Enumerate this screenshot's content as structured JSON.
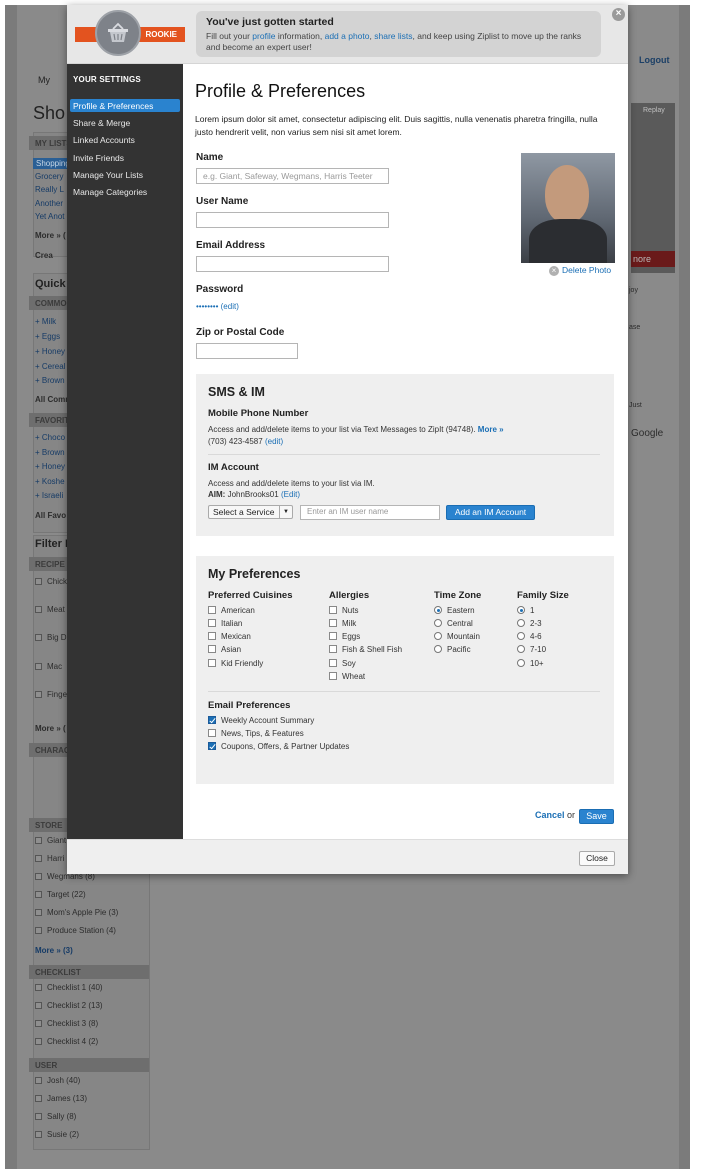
{
  "background": {
    "tab_my": "My",
    "logout": "Logout",
    "title_prefix": "Sho",
    "my_lists_header": "MY LISTS",
    "lists": [
      "Shopping",
      "Grocery",
      "Really L",
      "Another",
      "Yet Anot"
    ],
    "more_lists": "More » (",
    "create": "Crea",
    "quick_header": "Quick",
    "common_header": "COMMON",
    "common_items": [
      "+ Milk",
      "+ Eggs",
      "+ Honey",
      "+ Cereal",
      "+ Brown"
    ],
    "all_common": "All Comm",
    "favorites_header": "FAVORIT",
    "favorite_items": [
      "+ Choco",
      "+ Brown",
      "+ Honey",
      "+ Koshe",
      "+ Israeli"
    ],
    "all_favorites": "All Favo",
    "filter_header": "Filter I",
    "recipe_header": "RECIPE",
    "recipe_items": [
      "Chick",
      "Meat",
      "Big D",
      "Mac",
      "Finge"
    ],
    "more_recipes": "More » (",
    "character_header": "CHARAC",
    "store_header": "STORE",
    "store_items": [
      "Giant",
      "Harri",
      "Wegmans (8)",
      "Target (22)",
      "Mom's Apple Pie (3)",
      "Produce Station (4)"
    ],
    "more_stores": "More » (3)",
    "checklist_header": "CHECKLIST",
    "checklist_items": [
      "Checklist 1 (40)",
      "Checklist 2 (13)",
      "Checklist 3 (8)",
      "Checklist 4 (2)"
    ],
    "user_header": "USER",
    "user_items": [
      "Josh (40)",
      "James (13)",
      "Sally (8)",
      "Susie (2)"
    ],
    "replay": "Replay",
    "more_ad": "nore",
    "side_texts": [
      "joy",
      "ase",
      "Just",
      "Google"
    ]
  },
  "modal": {
    "badge": "ROOKIE",
    "notice_title": "You've just gotten started",
    "notice_text_1": "Fill out your ",
    "notice_link_profile": "profile",
    "notice_text_2": " information, ",
    "notice_link_photo": "add a photo",
    "notice_text_3": ", ",
    "notice_link_share": "share lists",
    "notice_text_4": ", and keep using Ziplist to move up the ranks and become an expert user!",
    "sidebar_header": "YOUR SETTINGS",
    "sidebar_items": [
      "Profile & Preferences",
      "Share & Merge",
      "Linked Accounts",
      "Invite Friends",
      "Manage Your Lists",
      "Manage Categories"
    ],
    "page_title": "Profile & Preferences",
    "intro": "Lorem ipsum dolor sit amet, consectetur adipiscing elit. Duis sagittis, nulla venenatis pharetra fringilla, nulla justo hendrerit velit, non varius sem nisi sit amet lorem.",
    "name_label": "Name",
    "name_placeholder": "e.g. Giant, Safeway, Wegmans, Harris Teeter",
    "username_label": "User Name",
    "email_label": "Email Address",
    "password_label": "Password",
    "password_mask": "••••••••",
    "edit_link": "(edit)",
    "zip_label": "Zip or Postal Code",
    "delete_photo": "Delete Photo",
    "sms_title": "SMS & IM",
    "mobile_label": "Mobile Phone Number",
    "mobile_desc": "Access and add/delete items to your list via Text Messages to ZipIt (94748).",
    "more_link": "More »",
    "phone": "(703) 423-4587",
    "phone_edit": "(edit)",
    "im_label": "IM Account",
    "im_desc": "Access and add/delete items to your list via IM.",
    "aim_label": "AIM:",
    "aim_value": "JohnBrooks01",
    "aim_edit": "(Edit)",
    "service_select": "Select a Service",
    "im_placeholder": "Enter an IM user name",
    "add_im_button": "Add an IM Account",
    "pref_title": "My Preferences",
    "cuisines_header": "Preferred Cuisines",
    "cuisines": [
      "American",
      "Italian",
      "Mexican",
      "Asian",
      "Kid Friendly"
    ],
    "allergies_header": "Allergies",
    "allergies": [
      "Nuts",
      "Milk",
      "Eggs",
      "Fish & Shell Fish",
      "Soy",
      "Wheat"
    ],
    "timezone_header": "Time Zone",
    "timezones": [
      "Eastern",
      "Central",
      "Mountain",
      "Pacific"
    ],
    "timezone_selected": "Eastern",
    "family_header": "Family Size",
    "family_sizes": [
      "1",
      "2-3",
      "4-6",
      "7-10",
      "10+"
    ],
    "family_selected": "1",
    "email_pref_header": "Email Preferences",
    "email_prefs": [
      {
        "label": "Weekly Account Summary",
        "checked": true
      },
      {
        "label": "News, Tips, & Features",
        "checked": false
      },
      {
        "label": "Coupons, Offers, & Partner Updates",
        "checked": true
      }
    ],
    "cancel": "Cancel",
    "or": "or",
    "save": "Save",
    "close": "Close"
  },
  "colors": {
    "accent": "#2a83cf",
    "sidebar": "#333333",
    "badge_ribbon": "#e3531f"
  }
}
